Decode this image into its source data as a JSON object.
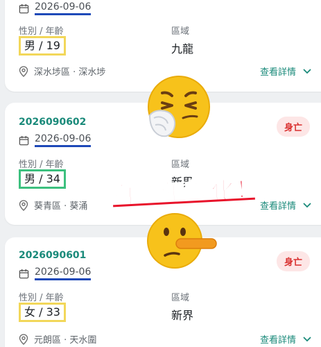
{
  "cards": [
    {
      "date": "2026-09-06",
      "gender_age_label": "性別 / 年齡",
      "gender_age": "男 / 19",
      "region_label": "區域",
      "region": "九龍",
      "location": "深水埗區 · 深水埗",
      "detail_label": "查看詳情"
    },
    {
      "case_id": "2026090602",
      "status": "身亡",
      "date": "2026-09-06",
      "gender_age_label": "性別 / 年齡",
      "gender_age": "男 / 34",
      "region_label": "區域",
      "region": "新界",
      "location": "葵青區 · 葵涌",
      "detail_label": "查看詳情"
    },
    {
      "case_id": "2026090601",
      "status": "身亡",
      "date": "2026-09-06",
      "gender_age_label": "性別 / 年齡",
      "gender_age": "女 / 33",
      "region_label": "區域",
      "region": "新界",
      "location": "元朗區 · 天水圍",
      "detail_label": "查看詳情"
    }
  ],
  "overlay": {
    "caption": "自殺年輕化！",
    "emoji_top": "sneezing-face-emoji",
    "emoji_bottom": "long-nose-face-emoji"
  },
  "colors": {
    "accent_teal": "#1a8a7a",
    "status_red": "#d9302f",
    "date_underline_blue": "#1e49b8",
    "highlight_yellow": "#f2d75a",
    "highlight_green": "#3cc07e",
    "caption_red": "#e8132b"
  }
}
